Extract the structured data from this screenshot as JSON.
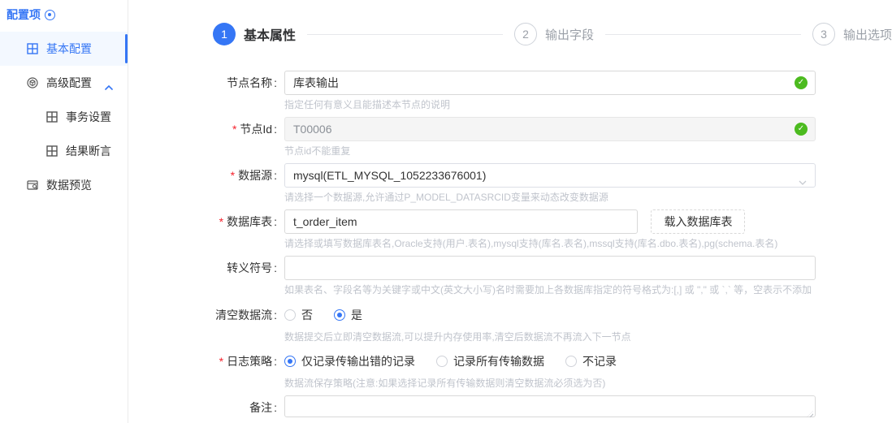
{
  "colors": {
    "primary": "#3576f5",
    "success": "#4cbb1f",
    "danger": "#f5222d",
    "text": "#303133",
    "muted": "#c0c4cc",
    "border": "#d9d9d9"
  },
  "sidebar": {
    "title": "配置项",
    "items": [
      {
        "label": "基本配置",
        "icon": "grid-icon",
        "active": true
      },
      {
        "label": "高级配置",
        "icon": "cube-icon",
        "expanded": true
      },
      {
        "label": "事务设置",
        "icon": "grid-icon",
        "sub": true
      },
      {
        "label": "结果断言",
        "icon": "grid-icon",
        "sub": true
      },
      {
        "label": "数据预览",
        "icon": "preview-icon"
      }
    ]
  },
  "stepper": {
    "steps": [
      {
        "number": "1",
        "label": "基本属性",
        "state": "active"
      },
      {
        "number": "2",
        "label": "输出字段",
        "state": "pending"
      },
      {
        "number": "3",
        "label": "输出选项",
        "state": "pending"
      }
    ]
  },
  "form": {
    "node_name": {
      "label": "节点名称",
      "required": false,
      "value": "库表输出",
      "valid": true,
      "help": "指定任何有意义且能描述本节点的说明"
    },
    "node_id": {
      "label": "节点Id",
      "required": true,
      "value": "T00006",
      "disabled": true,
      "valid": true,
      "help": "节点id不能重复"
    },
    "datasource": {
      "label": "数据源",
      "required": true,
      "value": "mysql(ETL_MYSQL_1052233676001)",
      "help": "请选择一个数据源,允许通过P_MODEL_DATASRCID变量来动态改变数据源"
    },
    "db_table": {
      "label": "数据库表",
      "required": true,
      "value": "t_order_item",
      "button": "载入数据库表",
      "help": "请选择或填写数据库表名,Oracle支持(用户.表名),mysql支持(库名.表名),mssql支持(库名.dbo.表名),pg(schema.表名)"
    },
    "escape_symbol": {
      "label": "转义符号",
      "required": false,
      "value": "",
      "help": "如果表名、字段名等为关键字或中文(英文大小写)名时需要加上各数据库指定的符号格式为:[,] 或 \",\" 或 `,` 等，空表示不添加"
    },
    "clear_stream": {
      "label": "清空数据流",
      "required": false,
      "options": [
        {
          "label": "否",
          "selected": false
        },
        {
          "label": "是",
          "selected": true
        }
      ],
      "value": "是",
      "help": "数据提交后立即清空数据流,可以提升内存使用率,清空后数据流不再流入下一节点"
    },
    "log_policy": {
      "label": "日志策略",
      "required": true,
      "options": [
        {
          "label": "仅记录传输出错的记录",
          "selected": true
        },
        {
          "label": "记录所有传输数据",
          "selected": false
        },
        {
          "label": "不记录",
          "selected": false
        }
      ],
      "value": "仅记录传输出错的记录",
      "help": "数据流保存策略(注意:如果选择记录所有传输数据则清空数据流必须选为否)"
    },
    "remark": {
      "label": "备注",
      "required": false,
      "value": ""
    }
  }
}
